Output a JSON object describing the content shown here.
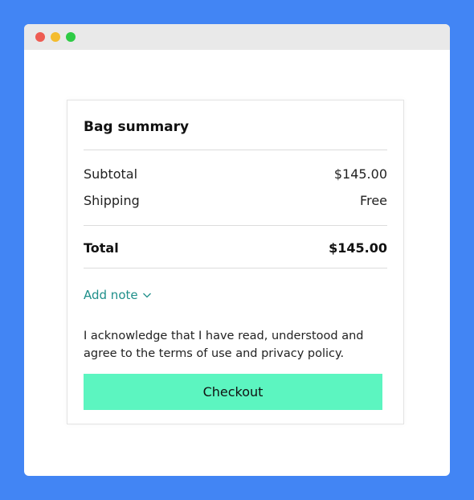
{
  "summary": {
    "title": "Bag summary",
    "subtotal_label": "Subtotal",
    "subtotal_value": "$145.00",
    "shipping_label": "Shipping",
    "shipping_value": "Free",
    "total_label": "Total",
    "total_value": "$145.00",
    "add_note_label": "Add note",
    "add_note_icon": "chevron-down-icon",
    "acknowledgement": "I acknowledge that I have read, understood and agree to the terms of use and privacy policy.",
    "checkout_label": "Checkout"
  },
  "colors": {
    "background": "#4285f4",
    "accent_link": "#1f8f8a",
    "checkout_button": "#5cf5c0"
  }
}
